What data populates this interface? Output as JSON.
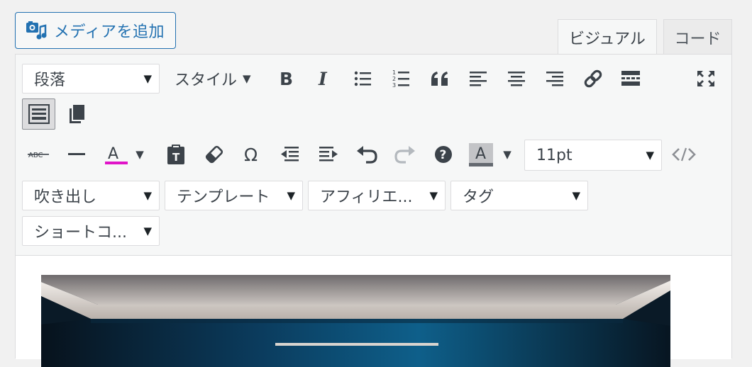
{
  "media_button": {
    "label": "メディアを追加",
    "icon": "media-icon"
  },
  "tabs": {
    "visual": "ビジュアル",
    "code": "コード"
  },
  "toolbar": {
    "format_select": "段落",
    "style_menu": "スタイル",
    "fontsize_select": "11pt",
    "selects": {
      "fukidashi": "吹き出し",
      "template": "テンプレート",
      "affiliate": "アフィリエ...",
      "tag": "タグ",
      "shortcode": "ショートコ..."
    },
    "text_color": "#e014c8",
    "bg_color_swatch": "#646970"
  },
  "content": {
    "image_alt": "room-photo"
  }
}
